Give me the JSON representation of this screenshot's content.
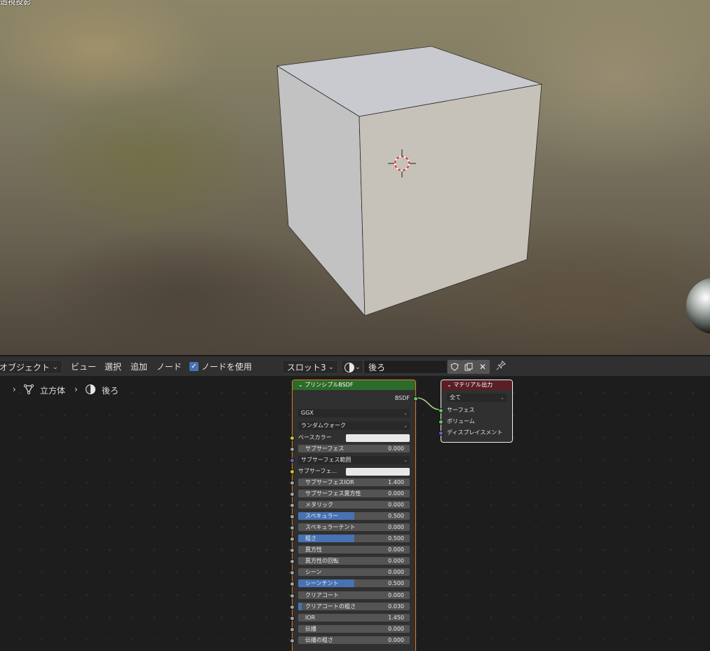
{
  "viewport": {
    "mode_label": "透視投影"
  },
  "header": {
    "editor_type": "オブジェクト",
    "menu": [
      "ビュー",
      "選択",
      "追加",
      "ノード"
    ],
    "use_nodes_label": "ノードを使用",
    "use_nodes_checked": true,
    "slot": "スロット3",
    "material_name": "後ろ"
  },
  "breadcrumb": {
    "object": "立方体",
    "material": "後ろ"
  },
  "bsdf_node": {
    "title": "プリンシプルBSDF",
    "output": "BSDF",
    "distribution": "GGX",
    "subsurface_method": "ランダムウォーク",
    "base_color_label": "ベースカラー",
    "subsurface_color_label": "サブサーフェ...",
    "subsurface_radius_label": "サブサーフェス範囲",
    "fields": [
      {
        "label": "サブサーフェス",
        "value": "0.000",
        "fill": 0
      },
      {
        "label": "サブサーフェスIOR",
        "value": "1.400",
        "fill": 0
      },
      {
        "label": "サブサーフェス異方性",
        "value": "0.000",
        "fill": 0
      },
      {
        "label": "メタリック",
        "value": "0.000",
        "fill": 0
      },
      {
        "label": "スペキュラー",
        "value": "0.500",
        "fill": 0.5
      },
      {
        "label": "スペキュラーテント",
        "value": "0.000",
        "fill": 0
      },
      {
        "label": "粗さ",
        "value": "0.500",
        "fill": 0.5
      },
      {
        "label": "異方性",
        "value": "0.000",
        "fill": 0
      },
      {
        "label": "異方性の回転",
        "value": "0.000",
        "fill": 0
      },
      {
        "label": "シーン",
        "value": "0.000",
        "fill": 0
      },
      {
        "label": "シーンチント",
        "value": "0.500",
        "fill": 0.5
      },
      {
        "label": "クリアコート",
        "value": "0.000",
        "fill": 0
      },
      {
        "label": "クリアコートの粗さ",
        "value": "0.030",
        "fill": 0.03
      },
      {
        "label": "IOR",
        "value": "1.450",
        "fill": 0
      },
      {
        "label": "伝播",
        "value": "0.000",
        "fill": 0
      },
      {
        "label": "伝播の粗さ",
        "value": "0.000",
        "fill": 0
      }
    ]
  },
  "output_node": {
    "title": "マテリアル出力",
    "target": "全て",
    "inputs": [
      "サーフェス",
      "ボリューム",
      "ディスプレイスメント"
    ]
  },
  "colors": {
    "bsdf_header": "#2b6b2b",
    "output_header": "#5a1f26",
    "accent": "#4772b3",
    "selected_outline": "#e07a1e"
  }
}
